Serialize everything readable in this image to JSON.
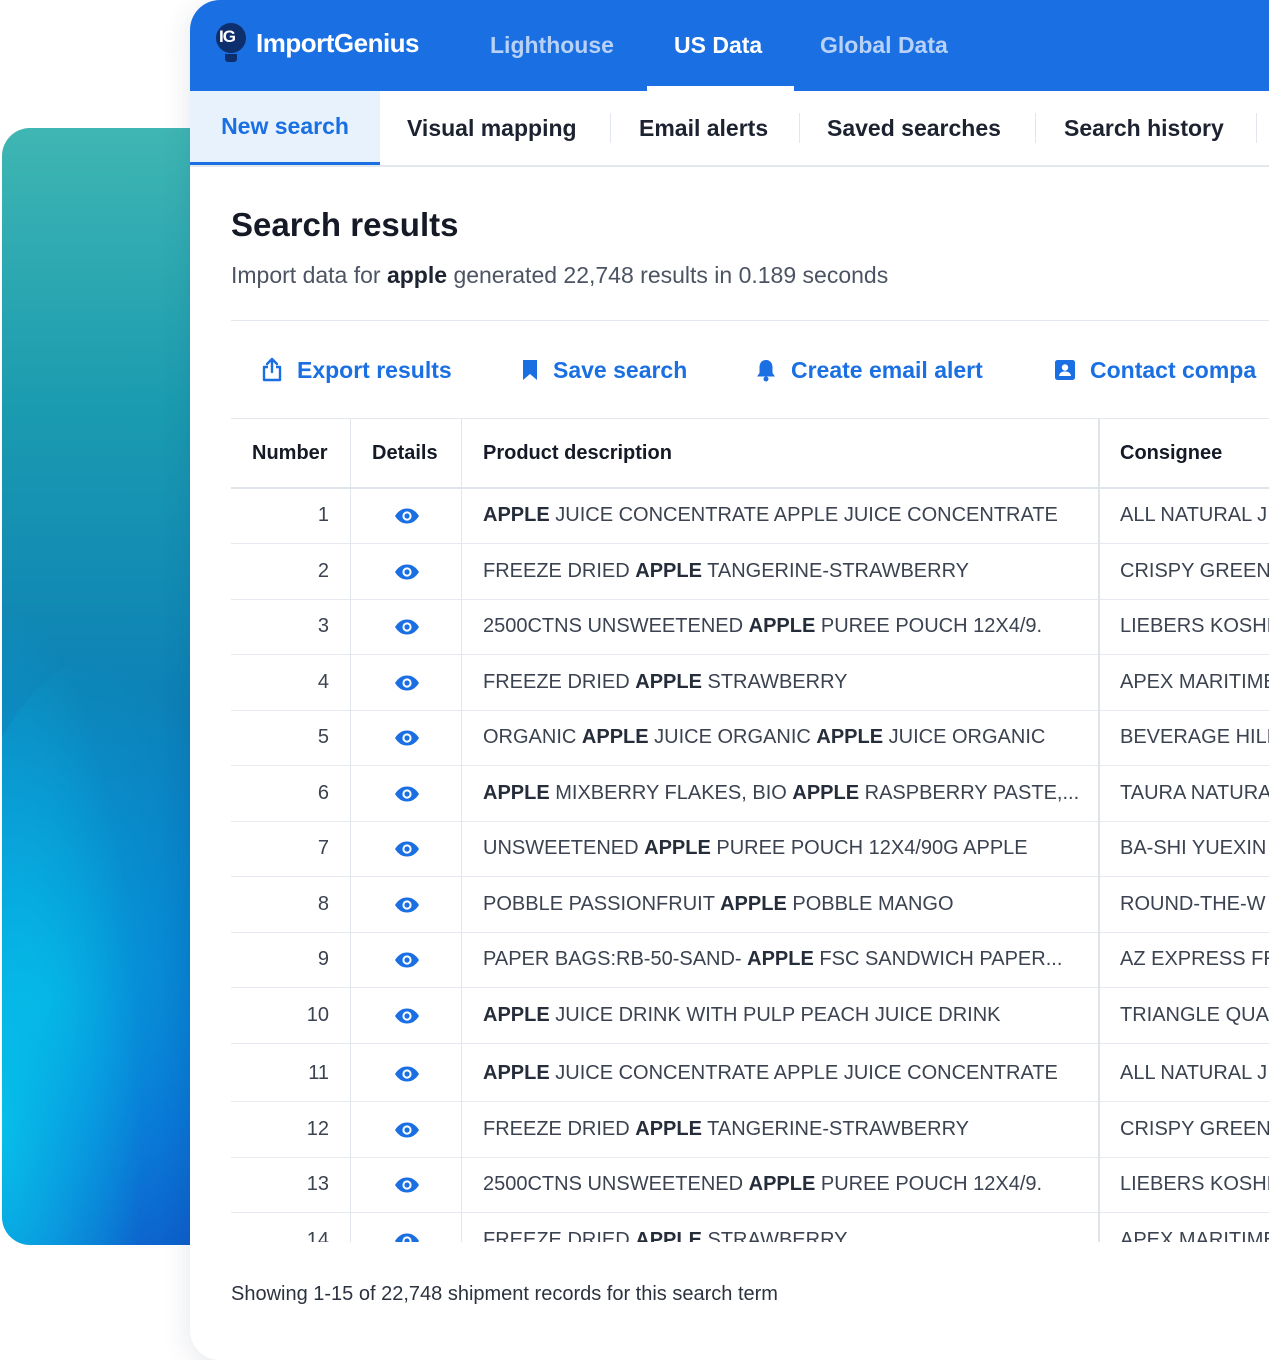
{
  "brand": {
    "logo_mark": "IG",
    "name": "ImportGenius"
  },
  "top_nav": [
    {
      "label": "Lighthouse",
      "active": false
    },
    {
      "label": "US Data",
      "active": true
    },
    {
      "label": "Global Data",
      "active": false
    }
  ],
  "sub_nav": [
    {
      "label": "New search",
      "active": true
    },
    {
      "label": "Visual mapping",
      "active": false
    },
    {
      "label": "Email alerts",
      "active": false
    },
    {
      "label": "Saved searches",
      "active": false
    },
    {
      "label": "Search history",
      "active": false
    }
  ],
  "results": {
    "title": "Search results",
    "summary_prefix": "Import data for",
    "search_term": "apple",
    "summary_suffix": "generated 22,748 results in 0.189 seconds"
  },
  "actions": [
    {
      "label": "Export results",
      "icon": "export-icon"
    },
    {
      "label": "Save search",
      "icon": "bookmark-icon"
    },
    {
      "label": "Create email alert",
      "icon": "bell-icon"
    },
    {
      "label": "Contact compa",
      "icon": "contact-card-icon"
    }
  ],
  "table": {
    "columns": [
      "Number",
      "Details",
      "Product description",
      "Consignee"
    ],
    "rows": [
      {
        "number": "1",
        "description": [
          [
            "APPLE",
            true
          ],
          [
            " JUICE CONCENTRATE APPLE JUICE CONCENTRATE",
            false
          ]
        ],
        "consignee": "ALL NATURAL J"
      },
      {
        "number": "2",
        "description": [
          [
            "FREEZE DRIED ",
            false
          ],
          [
            "APPLE",
            true
          ],
          [
            " TANGERINE-STRAWBERRY",
            false
          ]
        ],
        "consignee": "CRISPY GREEN"
      },
      {
        "number": "3",
        "description": [
          [
            "2500CTNS UNSWEETENED ",
            false
          ],
          [
            "APPLE",
            true
          ],
          [
            " PUREE POUCH 12X4/9.",
            false
          ]
        ],
        "consignee": "LIEBERS KOSHE"
      },
      {
        "number": "4",
        "description": [
          [
            "FREEZE DRIED ",
            false
          ],
          [
            "APPLE",
            true
          ],
          [
            " STRAWBERRY",
            false
          ]
        ],
        "consignee": "APEX MARITIME"
      },
      {
        "number": "5",
        "description": [
          [
            "ORGANIC ",
            false
          ],
          [
            "APPLE",
            true
          ],
          [
            " JUICE ORGANIC ",
            false
          ],
          [
            "APPLE",
            true
          ],
          [
            " JUICE ORGANIC",
            false
          ]
        ],
        "consignee": "BEVERAGE HILL"
      },
      {
        "number": "6",
        "description": [
          [
            "APPLE",
            true
          ],
          [
            " MIXBERRY FLAKES, BIO ",
            false
          ],
          [
            "APPLE",
            true
          ],
          [
            " RASPBERRY PASTE,...",
            false
          ]
        ],
        "consignee": "TAURA NATURA"
      },
      {
        "number": "7",
        "description": [
          [
            "UNSWEETENED ",
            false
          ],
          [
            "APPLE",
            true
          ],
          [
            " PUREE POUCH 12X4/90G APPLE",
            false
          ]
        ],
        "consignee": "BA-SHI YUEXIN"
      },
      {
        "number": "8",
        "description": [
          [
            "POBBLE PASSIONFRUIT ",
            false
          ],
          [
            "APPLE",
            true
          ],
          [
            " POBBLE MANGO",
            false
          ]
        ],
        "consignee": "ROUND-THE-W"
      },
      {
        "number": "9",
        "description": [
          [
            "PAPER BAGS:RB-50-SAND- ",
            false
          ],
          [
            "APPLE",
            true
          ],
          [
            " FSC SANDWICH PAPER...",
            false
          ]
        ],
        "consignee": "AZ EXPRESS FR"
      },
      {
        "number": "10",
        "description": [
          [
            "APPLE",
            true
          ],
          [
            " JUICE DRINK WITH PULP PEACH JUICE DRINK",
            false
          ]
        ],
        "consignee": "TRIANGLE QUA"
      },
      {
        "number": "11",
        "description": [
          [
            "APPLE",
            true
          ],
          [
            " JUICE CONCENTRATE APPLE JUICE CONCENTRATE",
            false
          ]
        ],
        "consignee": "ALL NATURAL J"
      },
      {
        "number": "12",
        "description": [
          [
            "FREEZE DRIED ",
            false
          ],
          [
            "APPLE",
            true
          ],
          [
            " TANGERINE-STRAWBERRY",
            false
          ]
        ],
        "consignee": "CRISPY GREEN"
      },
      {
        "number": "13",
        "description": [
          [
            "2500CTNS UNSWEETENED ",
            false
          ],
          [
            "APPLE",
            true
          ],
          [
            " PUREE POUCH 12X4/9.",
            false
          ]
        ],
        "consignee": "LIEBERS KOSHE"
      },
      {
        "number": "14",
        "description": [
          [
            "FREEZE DRIED ",
            false
          ],
          [
            "APPLE",
            true
          ],
          [
            " STRAWBERRY",
            false
          ]
        ],
        "consignee": "APEX MARITIME"
      }
    ]
  },
  "footer": {
    "text": "Showing 1-15 of 22,748 shipment records for this search term"
  },
  "colors": {
    "brand_blue": "#1a6fe3",
    "active_tab_bg": "#e8f2fd",
    "text_dark": "#151a26"
  }
}
